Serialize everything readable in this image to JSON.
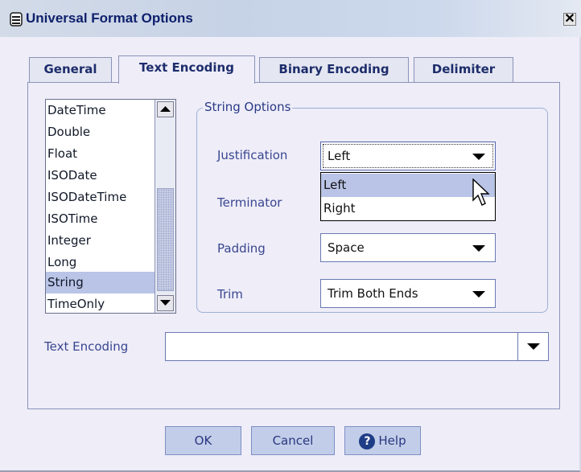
{
  "window": {
    "title": "Universal Format Options",
    "close_glyph": "✕"
  },
  "tabs": [
    {
      "label": "General"
    },
    {
      "label": "Text Encoding",
      "active": true
    },
    {
      "label": "Binary Encoding"
    },
    {
      "label": "Delimiter"
    }
  ],
  "types_list": {
    "items": [
      "DateTime",
      "Double",
      "Float",
      "ISODate",
      "ISODateTime",
      "ISOTime",
      "Integer",
      "Long",
      "String",
      "TimeOnly"
    ],
    "selected": "String"
  },
  "string_options": {
    "group_label": "String Options",
    "justification": {
      "label": "Justification",
      "value": "Left",
      "options": [
        "Left",
        "Right"
      ],
      "highlighted": "Left"
    },
    "terminator": {
      "label": "Terminator"
    },
    "padding": {
      "label": "Padding",
      "value": "Space"
    },
    "trim": {
      "label": "Trim",
      "value": "Trim Both Ends"
    }
  },
  "text_encoding": {
    "label": "Text Encoding",
    "value": ""
  },
  "buttons": {
    "ok": "OK",
    "cancel": "Cancel",
    "help": "Help"
  },
  "colors": {
    "accent": "#b9c4e6",
    "titlebar": "#c6d2e6",
    "background": "#eeedf8",
    "button": "#c2cde9"
  },
  "icons": {
    "window": "app-icon",
    "help": "help-question-icon",
    "cursor": "mouse-pointer-icon"
  }
}
